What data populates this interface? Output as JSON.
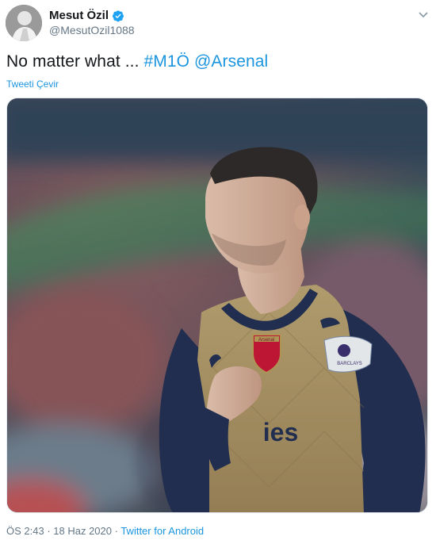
{
  "user": {
    "display_name": "Mesut Özil",
    "handle": "@MesutOzil1088",
    "verified_icon": "verified-badge-icon",
    "avatar_icon": "avatar"
  },
  "tweet": {
    "text_plain": "No matter what ... ",
    "hashtag": "#M1Ö",
    "mention": "@Arsenal",
    "translate_label": "Tweeti Çevir"
  },
  "media": {
    "image_icon": "photo",
    "shirt_sponsor": "ies",
    "crest_label": "Arsenal",
    "sleeve_badge_text": "BARCLAYS"
  },
  "meta": {
    "time": "ÖS 2:43",
    "separator": " · ",
    "date": "18 Haz 2020",
    "source": "Twitter for Android"
  },
  "colors": {
    "link": "#1b95e0",
    "muted": "#657786",
    "verified": "#1da1f2"
  }
}
